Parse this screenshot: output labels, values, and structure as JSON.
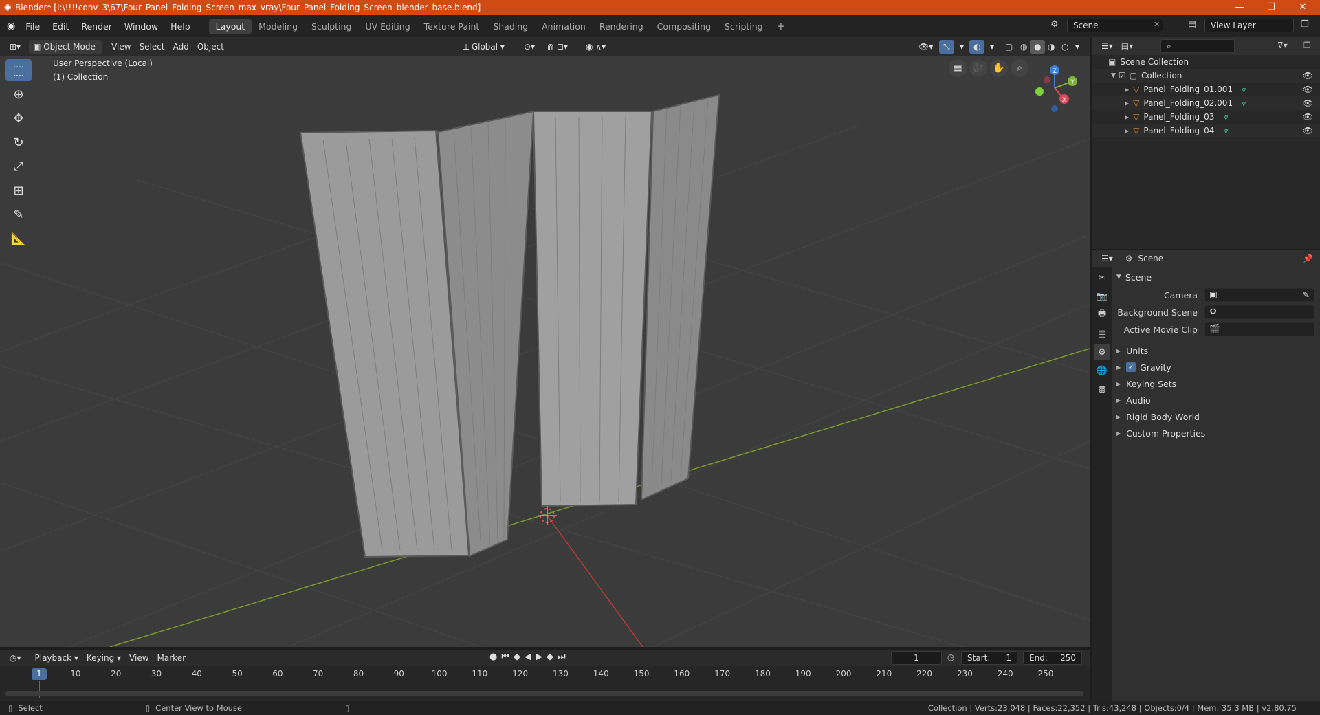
{
  "title_bar": {
    "title": "Blender* [I:\\!!!!conv_3\\67\\Four_Panel_Folding_Screen_max_vray\\Four_Panel_Folding_Screen_blender_base.blend]",
    "minimize": "—",
    "maximize": "❐",
    "close": "✕"
  },
  "menu": {
    "items": [
      "File",
      "Edit",
      "Render",
      "Window",
      "Help"
    ]
  },
  "workspaces": {
    "tabs": [
      "Layout",
      "Modeling",
      "Sculpting",
      "UV Editing",
      "Texture Paint",
      "Shading",
      "Animation",
      "Rendering",
      "Compositing",
      "Scripting"
    ],
    "active": "Layout",
    "add": "+"
  },
  "scene_selector": {
    "value": "Scene"
  },
  "view_layer_selector": {
    "value": "View Layer"
  },
  "viewport_header": {
    "mode": "Object Mode",
    "menus": [
      "View",
      "Select",
      "Add",
      "Object"
    ],
    "transform_orientation": "Global"
  },
  "viewport": {
    "perspective_label": "User Perspective (Local)",
    "collection_label": "(1) Collection",
    "gizmo_axes": {
      "x": "X",
      "y": "Y",
      "z": "Z"
    }
  },
  "outliner": {
    "root": "Scene Collection",
    "collection": "Collection",
    "objects": [
      "Panel_Folding_01.001",
      "Panel_Folding_02.001",
      "Panel_Folding_03",
      "Panel_Folding_04"
    ]
  },
  "properties": {
    "header_title": "Scene",
    "section_title": "Scene",
    "fields": [
      {
        "label": "Camera"
      },
      {
        "label": "Background Scene"
      },
      {
        "label": "Active Movie Clip"
      }
    ],
    "panels": [
      "Units",
      "Gravity",
      "Keying Sets",
      "Audio",
      "Rigid Body World",
      "Custom Properties"
    ],
    "gravity_checked": true
  },
  "timeline": {
    "menus": [
      "Playback",
      "Keying",
      "View",
      "Marker"
    ],
    "current_frame": "1",
    "start_label": "Start:",
    "start": "1",
    "end_label": "End:",
    "end": "250",
    "ruler": [
      "1",
      "10",
      "20",
      "30",
      "40",
      "50",
      "60",
      "70",
      "80",
      "90",
      "100",
      "110",
      "120",
      "130",
      "140",
      "150",
      "160",
      "170",
      "180",
      "190",
      "200",
      "210",
      "220",
      "230",
      "240",
      "250"
    ]
  },
  "status_bar": {
    "select": "Select",
    "center_view": "Center View to Mouse",
    "stats": "Collection | Verts:23,048 | Faces:22,352 | Tris:43,248 | Objects:0/4 | Mem: 35.3 MB | v2.80.75"
  },
  "colors": {
    "accent": "#4a6f9e",
    "title_bar": "#d04a14",
    "object_icon": "#e08a2c",
    "mesh_icon": "#3fbf9f"
  }
}
